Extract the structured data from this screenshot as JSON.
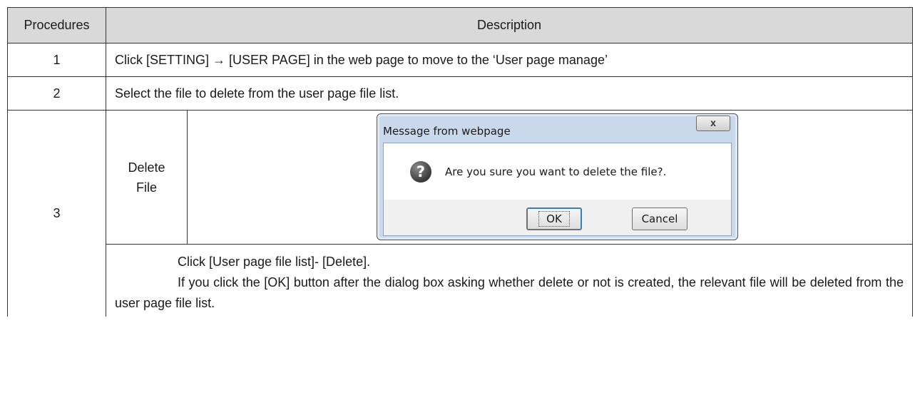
{
  "table": {
    "headers": {
      "procedures": "Procedures",
      "description": "Description"
    },
    "rows": [
      {
        "num": "1",
        "text": "Click [SETTING] → [USER PAGE] in the web page to move to the ‘User page manage’"
      },
      {
        "num": "2",
        "text": "Select the file to delete from the user page file list."
      },
      {
        "num": "3",
        "sub_label": "Delete File"
      }
    ],
    "notes": [
      "Click [User page file list]- [Delete].",
      "If you click the [OK] button after the dialog box asking whether delete or not is created, the relevant file will be deleted from the user page file list."
    ]
  },
  "dialog": {
    "title": "Message from webpage",
    "close_glyph": "x",
    "icon": "question-icon",
    "icon_glyph": "?",
    "message": "Are you sure you want to delete the file?.",
    "ok_label": "OK",
    "cancel_label": "Cancel"
  }
}
